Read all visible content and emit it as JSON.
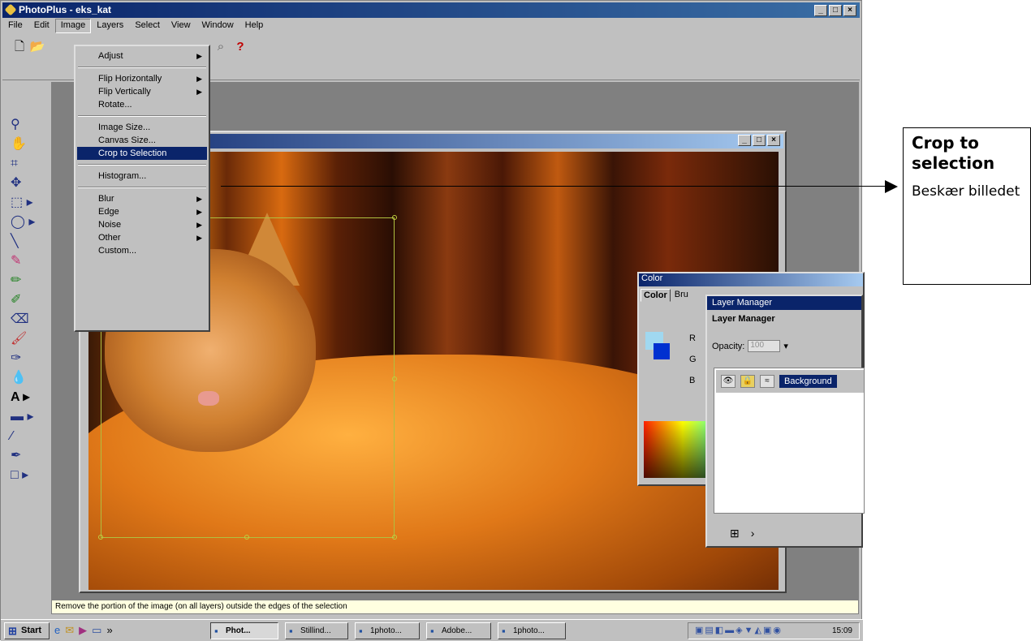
{
  "app": {
    "title": "PhotoPlus - eks_kat",
    "window_buttons": [
      "_",
      "□",
      "×"
    ]
  },
  "menubar": {
    "items": [
      "File",
      "Edit",
      "Image",
      "Layers",
      "Select",
      "View",
      "Window",
      "Help"
    ]
  },
  "image_menu": {
    "items": [
      {
        "label": "Adjust",
        "submenu": true
      },
      {
        "label": "Flip Horizontally",
        "submenu": true
      },
      {
        "label": "Flip Vertically",
        "submenu": true
      },
      {
        "label": "Rotate...",
        "submenu": false
      },
      {
        "label": "Image Size...",
        "submenu": false
      },
      {
        "label": "Canvas Size...",
        "submenu": false
      },
      {
        "label": "Crop to Selection",
        "submenu": false,
        "highlighted": true
      },
      {
        "label": "Histogram...",
        "submenu": false
      },
      {
        "label": "Blur",
        "submenu": true
      },
      {
        "label": "Edge",
        "submenu": true
      },
      {
        "label": "Noise",
        "submenu": true
      },
      {
        "label": "Other",
        "submenu": true
      },
      {
        "label": "Custom...",
        "submenu": false
      }
    ]
  },
  "color_panel": {
    "title": "Color",
    "tabs": [
      "Color",
      "Bru"
    ],
    "channels": [
      "R",
      "G",
      "B"
    ],
    "foreground_color": "#0030d0",
    "background_color": "#a0d8f0"
  },
  "layer_manager": {
    "title": "Layer Manager",
    "tab_label": "Layer Manager",
    "opacity_label": "Opacity:",
    "opacity_value": "100",
    "layer_name": "Background"
  },
  "status": {
    "text": "Remove the portion of the image (on all layers) outside the edges of the selection"
  },
  "taskbar": {
    "start_label": "Start",
    "tasks": [
      "Phot...",
      "Stillind...",
      "1photo...",
      "Adobe...",
      "1photo..."
    ],
    "clock": "15:09"
  },
  "callout": {
    "title": "Crop to selection",
    "description": "Beskær billedet"
  },
  "colors": {
    "titlebar": "#0a246a",
    "chrome": "#c0c0c0",
    "highlight": "#0a246a"
  }
}
